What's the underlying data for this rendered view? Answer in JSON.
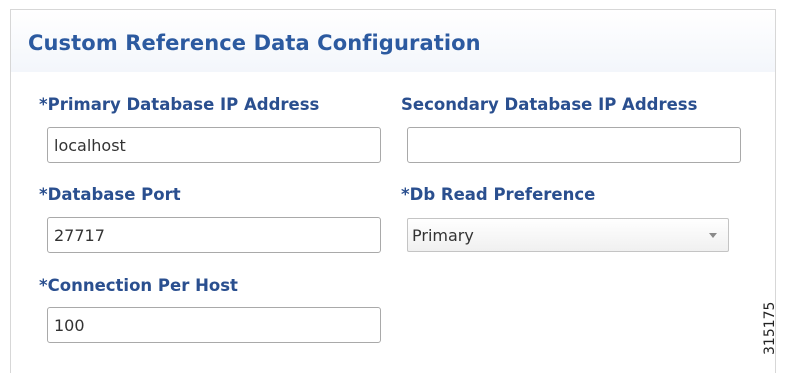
{
  "panel": {
    "title": "Custom Reference Data Configuration"
  },
  "fields": {
    "primary_db_ip": {
      "label": "*Primary Database IP Address",
      "value": "localhost"
    },
    "secondary_db_ip": {
      "label": "Secondary Database IP Address",
      "value": ""
    },
    "database_port": {
      "label": "*Database Port",
      "value": "27717"
    },
    "db_read_preference": {
      "label": "*Db Read Preference",
      "selected": "Primary"
    },
    "connection_per_host": {
      "label": "*Connection Per Host",
      "value": "100"
    }
  },
  "figure_id": "315175",
  "colors": {
    "title": "#2c5aa0",
    "label": "#2a4f8f"
  }
}
